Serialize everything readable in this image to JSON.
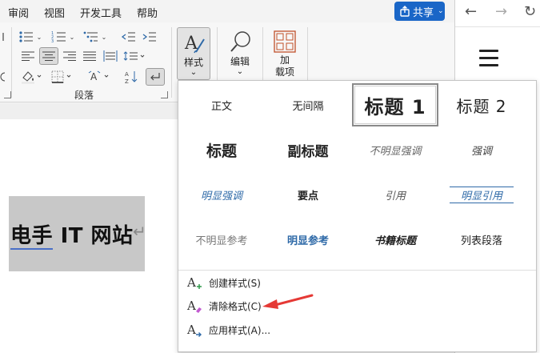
{
  "menu": {
    "items": [
      {
        "label": "审阅"
      },
      {
        "label": "视图"
      },
      {
        "label": "开发工具"
      },
      {
        "label": "帮助"
      }
    ],
    "share_label": "共享"
  },
  "ribbon": {
    "paragraph_group_label": "段落",
    "styles_button_label": "样式",
    "edit_button_label": "编辑",
    "addin_button_label_line1": "加",
    "addin_button_label_line2": "载项"
  },
  "document": {
    "text_underlined": "电手",
    "text_rest": " IT 网站",
    "para_mark": "↵"
  },
  "gallery": {
    "styles": [
      {
        "label": "正文"
      },
      {
        "label": "无间隔"
      },
      {
        "label": "标题 1"
      },
      {
        "label": "标题 2"
      },
      {
        "label": "标题"
      },
      {
        "label": "副标题"
      },
      {
        "label": "不明显强调"
      },
      {
        "label": "强调"
      },
      {
        "label": "明显强调"
      },
      {
        "label": "要点"
      },
      {
        "label": "引用"
      },
      {
        "label": "明显引用"
      },
      {
        "label": "不明显参考"
      },
      {
        "label": "明显参考"
      },
      {
        "label": "书籍标题"
      },
      {
        "label": "列表段落"
      }
    ],
    "commands": [
      {
        "label": "创建样式(S)"
      },
      {
        "label": "清除格式(C)"
      },
      {
        "label": "应用样式(A)..."
      }
    ]
  },
  "colors": {
    "accent": "#1a66c7",
    "style_blue": "#2f6aa8",
    "annotation": "#e53935"
  }
}
